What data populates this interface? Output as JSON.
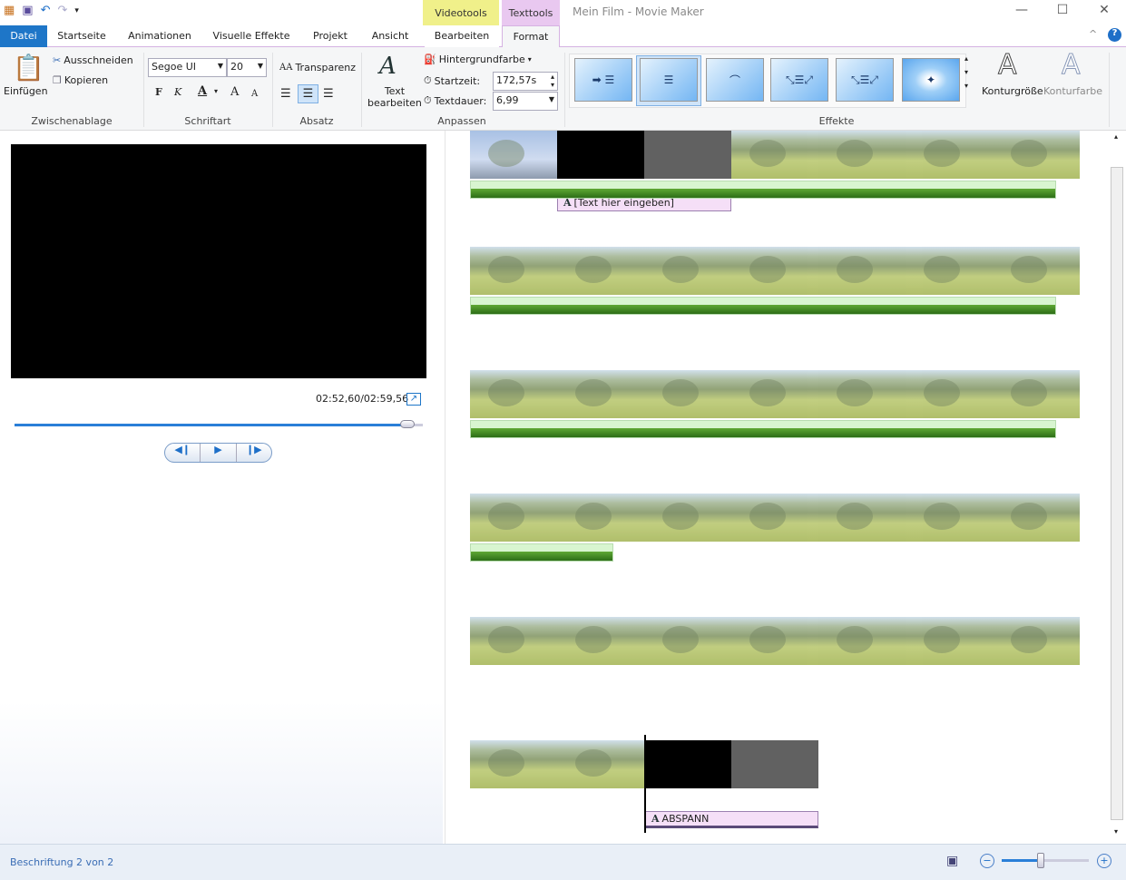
{
  "window": {
    "title": "Mein Film - Movie Maker",
    "minimize": "—",
    "maximize": "☐",
    "close": "✕",
    "collapse": "^",
    "help": "?"
  },
  "context_tabs": {
    "video": "Videotools",
    "text": "Texttools"
  },
  "tabs": [
    "Datei",
    "Startseite",
    "Animationen",
    "Visuelle Effekte",
    "Projekt",
    "Ansicht",
    "Bearbeiten",
    "Format"
  ],
  "clipboard": {
    "paste": "Einfügen",
    "cut": "Ausschneiden",
    "copy": "Kopieren",
    "label": "Zwischenablage"
  },
  "font": {
    "family": "Segoe UI",
    "size": "20",
    "bold": "F",
    "italic": "K",
    "color": "A",
    "grow": "A",
    "shrink": "A",
    "label": "Schriftart"
  },
  "paragraph": {
    "transparency": "Transparenz",
    "label": "Absatz"
  },
  "adjust": {
    "edit_text_1": "Text",
    "edit_text_2": "bearbeiten",
    "bg_color": "Hintergrundfarbe",
    "start_label": "Startzeit:",
    "start_value": "172,57s",
    "duration_label": "Textdauer:",
    "duration_value": "6,99",
    "label": "Anpassen"
  },
  "effects": {
    "label": "Effekte",
    "outline_size": "Konturgröße",
    "outline_color": "Konturfarbe",
    "selected_index": 1
  },
  "player": {
    "time": "02:52,60/02:59,56",
    "progress": 0.97
  },
  "timeline": {
    "caption1": "[Text hier eingeben]",
    "caption2": "ABSPANN"
  },
  "status": {
    "text": "Beschriftung 2 von 2",
    "zoom": 0.45
  },
  "colors": {
    "file_tab": "#1e76c8",
    "video_tools": "#f0f08a",
    "text_tools": "#e9c8f0",
    "accent": "#1e76c8"
  }
}
